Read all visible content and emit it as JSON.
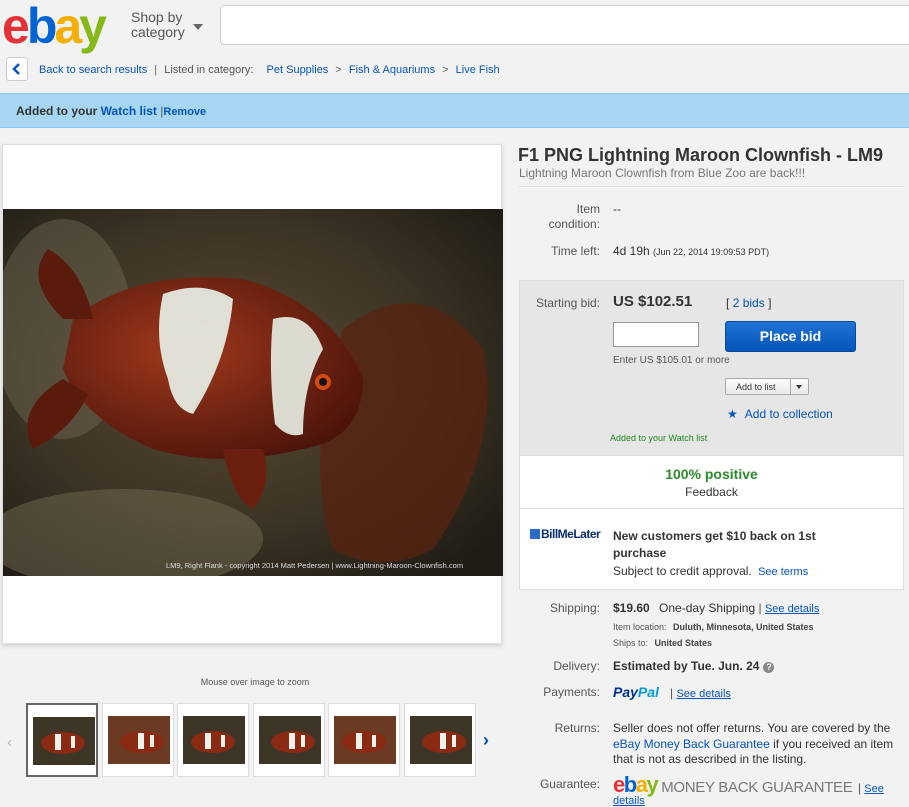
{
  "header": {
    "logo_letters": [
      "e",
      "b",
      "a",
      "y"
    ],
    "shop_by": "Shop by",
    "category": "category",
    "search_placeholder": ""
  },
  "breadcrumb": {
    "back": "Back to search results",
    "listed_in": "Listed in category:",
    "categories": [
      "Pet Supplies",
      "Fish & Aquariums",
      "Live Fish"
    ],
    "separator": ">"
  },
  "watchbar": {
    "added_prefix": "Added to your",
    "watch_list": "Watch list",
    "remove": "Remove"
  },
  "image": {
    "caption": "LM9, Right Flank - copyright 2014 Matt Pedersen | www.Lightning-Maroon-Clownfish.com",
    "zoom_hint": "Mouse over image to zoom",
    "thumb_count": 6
  },
  "item": {
    "title": "F1 PNG Lightning Maroon Clownfish - LM9",
    "subtitle": "Lightning Maroon Clownfish from Blue Zoo are back!!!",
    "condition_label_1": "Item",
    "condition_label_2": "condition:",
    "condition_value": "--",
    "time_left_label": "Time left:",
    "time_left_value": "4d 19h",
    "time_left_detail": "(Jun 22, 2014   19:09:53 PDT)"
  },
  "bid": {
    "starting_label": "Starting bid:",
    "price": "US $102.51",
    "bids_open": "[",
    "bids_link": "2 bids",
    "bids_close": "]",
    "input_value": "",
    "place_bid": "Place bid",
    "enter_hint": "Enter US $105.01 or more",
    "add_to_list": "Add to list",
    "add_to_collection": "Add to collection",
    "added_watch": "Added to your Watch list"
  },
  "feedback": {
    "positive": "100% positive",
    "label": "Feedback"
  },
  "billmelater": {
    "logo": "BillMeLater",
    "headline": "New customers get $10 back on 1st purchase",
    "sub": "Subject to credit approval.",
    "see_terms": "See terms"
  },
  "shipping": {
    "label": "Shipping:",
    "cost": "$19.60",
    "method": "One-day Shipping",
    "see_details": "See details",
    "item_location_label": "Item location:",
    "item_location": "Duluth, Minnesota, United States",
    "ships_to_label": "Ships to:",
    "ships_to": "United States"
  },
  "delivery": {
    "label": "Delivery:",
    "value": "Estimated by Tue. Jun. 24"
  },
  "payments": {
    "label": "Payments:",
    "paypal_1": "Pay",
    "paypal_2": "Pal",
    "see_details": "See details"
  },
  "returns": {
    "label": "Returns:",
    "text_1": "Seller does not offer returns. You are covered by the",
    "link": "eBay Money Back Guarantee",
    "text_2": "if you received an item that is not as described in the listing."
  },
  "guarantee": {
    "label": "Guarantee:",
    "mbg_text": "MONEY BACK GUARANTEE",
    "see": "See",
    "details": "details"
  },
  "colors": {
    "link": "#0654ba",
    "watchbar": "#a6d6f1",
    "place_bid": "#0654ba",
    "positive": "#2b8a2b"
  }
}
